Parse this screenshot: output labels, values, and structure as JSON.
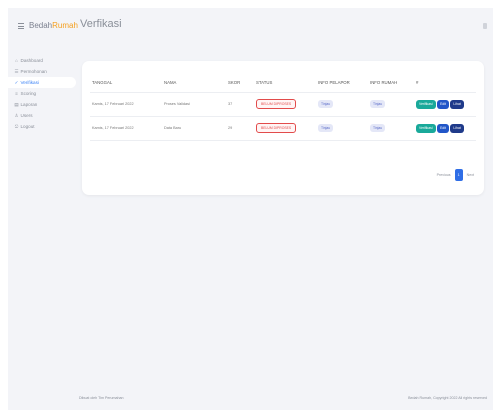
{
  "topbar": {
    "brand_part1": "Bedah",
    "brand_part2": "Rumah",
    "page_title": "Verfikasi"
  },
  "sidebar": {
    "items": [
      {
        "icon": "⌂",
        "label": "Dashboard"
      },
      {
        "icon": "☰",
        "label": "Permohonan"
      },
      {
        "icon": "✓",
        "label": "Verifikasi"
      },
      {
        "icon": "≡",
        "label": "Scoring"
      },
      {
        "icon": "▤",
        "label": "Laporan"
      },
      {
        "icon": "♙",
        "label": "Users"
      },
      {
        "icon": "⎋",
        "label": "Logout"
      }
    ],
    "active_index": 2
  },
  "table": {
    "columns": [
      "TANGGAL",
      "NAMA",
      "SKOR",
      "STATUS",
      "INFO PELAPOR",
      "INFO RUMAH",
      "#"
    ],
    "rows": [
      {
        "tanggal": "Kamis, 17 Februari 2022",
        "nama": "Proses Validasi",
        "skor": "37",
        "status": "BELUM DIPROSES",
        "info_pelapor": "Tinjau",
        "info_rumah": "Tinjau"
      },
      {
        "tanggal": "Kamis, 17 Februari 2022",
        "nama": "Data Baru",
        "skor": "29",
        "status": "BELUM DIPROSES",
        "info_pelapor": "Tinjau",
        "info_rumah": "Tinjau"
      }
    ],
    "actions": {
      "verify": "Verifikasi",
      "edit": "Edit",
      "detail": "Lihat"
    }
  },
  "pagination": {
    "previous": "Previous",
    "current": "1",
    "next": "Next"
  },
  "footer": {
    "left": "Dibuat oleh Tim Perumahan",
    "right": "Bedah Rumah, Copyright 2022 All rights reserved"
  },
  "colors": {
    "accent": "#f4a020",
    "active": "#3b82f6",
    "status_red": "#e24b4b",
    "verify_green": "#19a99a",
    "edit_blue": "#2156c8",
    "detail_navy": "#1f3a8a"
  }
}
